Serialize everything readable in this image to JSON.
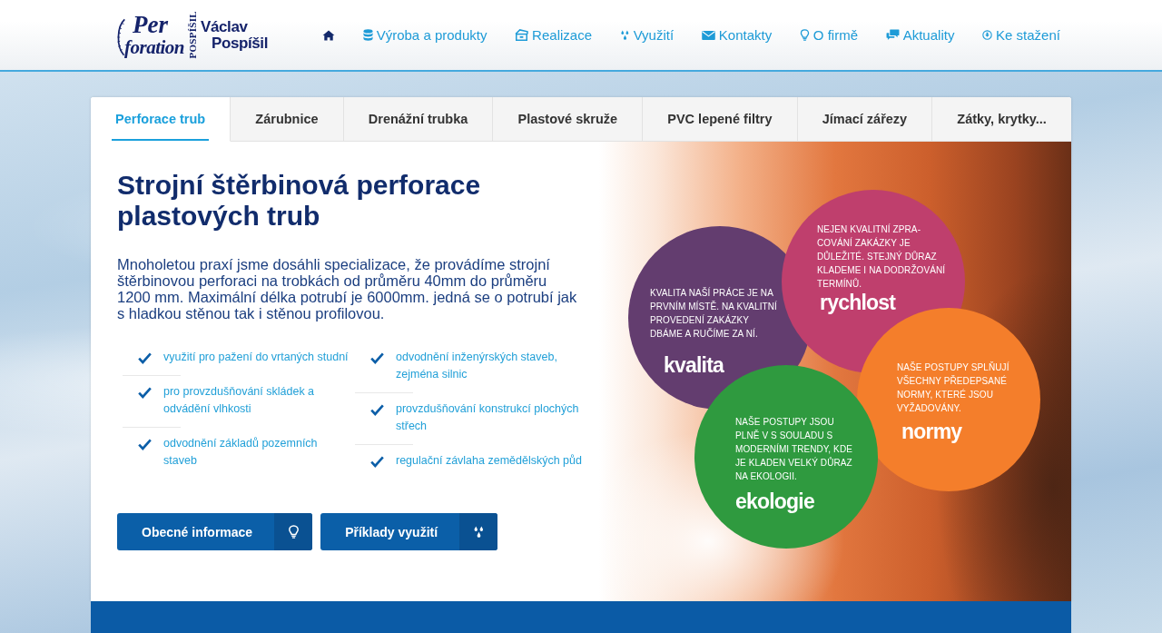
{
  "logo": {
    "script_top": "Per",
    "script_bottom": "foration",
    "vertical": "POSPÍŠIL",
    "name_first": "Václav",
    "name_last": "Pospíšil"
  },
  "nav": {
    "items": [
      {
        "label": "Výroba a produkty"
      },
      {
        "label": "Realizace"
      },
      {
        "label": "Využití"
      },
      {
        "label": "Kontakty"
      },
      {
        "label": "O firmě"
      },
      {
        "label": "Aktuality"
      },
      {
        "label": "Ke stažení"
      }
    ]
  },
  "tabs": [
    {
      "label": "Perforace trub",
      "selected": true
    },
    {
      "label": "Zárubnice",
      "selected": false
    },
    {
      "label": "Drenážní trubka",
      "selected": false
    },
    {
      "label": "Plastové skruže",
      "selected": false
    },
    {
      "label": "PVC lepené filtry",
      "selected": false
    },
    {
      "label": "Jímací zářezy",
      "selected": false
    },
    {
      "label": "Zátky, krytky...",
      "selected": false
    }
  ],
  "heading": "Strojní štěrbinová perforace plastových trub",
  "intro": "Mnoholetou praxí jsme dosáhli specializace, že provádíme strojní štěrbinovou perforaci na trobkách od průměru 40mm do průměru 1200 mm. Maximální délka potrubí je 6000mm. jedná se o potrubí jak s hladkou stěnou tak i stěnou profilovou.",
  "feature_columns": [
    {
      "items": [
        "využití pro pažení do vrtaných studní",
        "pro provzdušňování skládek a odvádění vlhkosti",
        "odvodnění základů pozemních staveb"
      ]
    },
    {
      "items": [
        "odvodnění inženýrských staveb, zejména silnic",
        "provzdušňování konstrukcí plochých střech",
        "regulační závlaha zemědělských půd"
      ]
    }
  ],
  "buttons": [
    {
      "label": "Obecné informace"
    },
    {
      "label": "Příklady využití"
    }
  ],
  "highlights": [
    {
      "title": "kvalita",
      "text": "KVALITA NAŠÍ PRÁCE JE NA\nPRVNÍM MÍSTĚ. NA KVALITNÍ\nPROVEDENÍ ZAKÁZKY\nDBÁME A RUČÍME ZA NÍ.",
      "color": "#633d6f"
    },
    {
      "title": "rychlost",
      "text": "NEJEN KVALITNÍ ZPRA-\nCOVÁNÍ ZAKÁZKY JE\nDŮLEŽITÉ. STEJNÝ DŮRAZ\nKLADEME I NA DODRŽOVÁNÍ\nTERMÍNŮ.",
      "color": "#bf3f6d"
    },
    {
      "title": "normy",
      "text": "NAŠE POSTUPY SPLŇUJÍ\nVŠECHNY PŘEDEPSANÉ\nNORMY, KTERÉ JSOU\nVYŽADOVÁNY.",
      "color": "#f47e2b"
    },
    {
      "title": "ekologie",
      "text": "NAŠE POSTUPY JSOU\nPLNĚ V S SOULADU S\nMODERNÍMI TRENDY, KDE\nJE KLADEN VELKÝ DŮRAZ\nNA EKOLOGII.",
      "color": "#2f9a3f"
    }
  ]
}
